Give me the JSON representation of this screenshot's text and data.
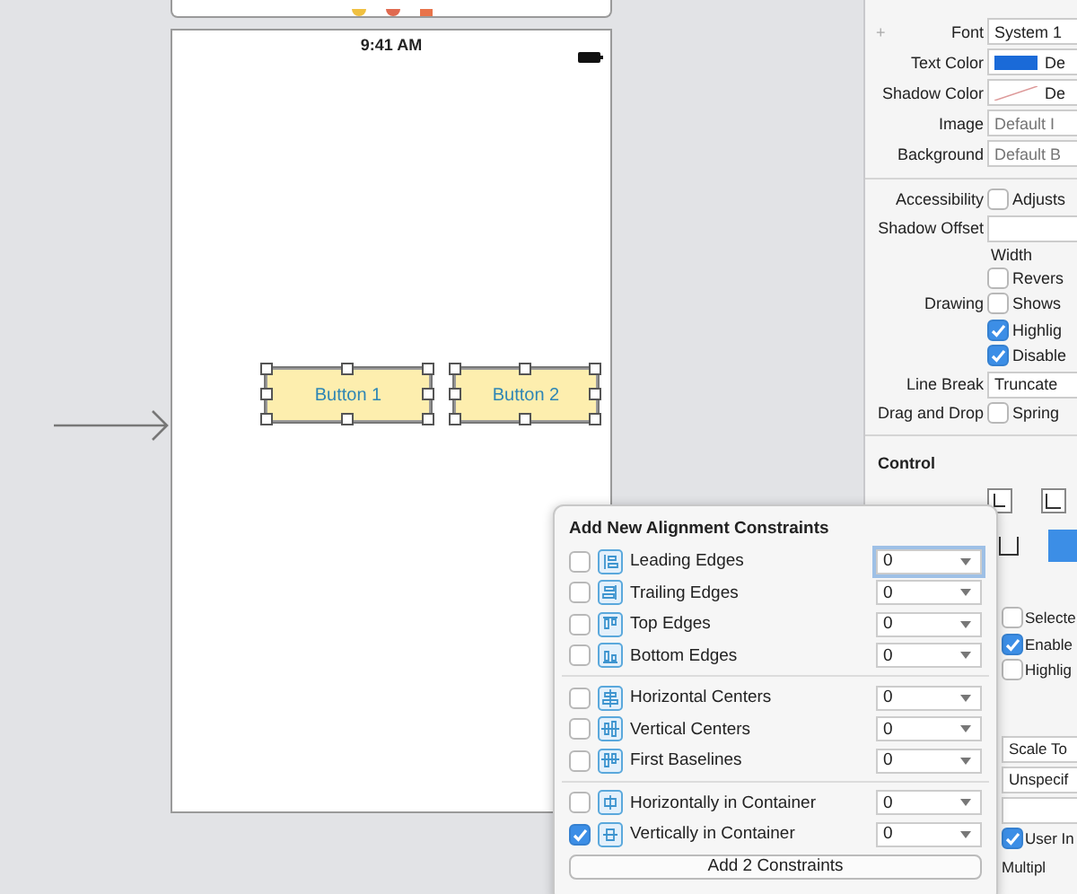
{
  "canvas": {
    "status_time": "9:41 AM",
    "buttons": [
      {
        "label": "Button 1",
        "selected": true
      },
      {
        "label": "Button 2",
        "selected": true
      }
    ]
  },
  "inspector": {
    "sections": [
      {
        "divided": false,
        "rows": [
          {
            "kind": "field",
            "label": "Font",
            "value": "System 1",
            "add": "+"
          },
          {
            "kind": "color",
            "label": "Text Color",
            "value": "De",
            "color": "#1a6ad8"
          },
          {
            "kind": "clear-color",
            "label": "Shadow Color",
            "value": "De"
          },
          {
            "kind": "placeholder",
            "label": "Image",
            "placeholder": "Default I"
          },
          {
            "kind": "placeholder",
            "label": "Background",
            "placeholder": "Default B"
          }
        ]
      },
      {
        "divided": true,
        "rows": [
          {
            "kind": "checkbox",
            "label": "Accessibility",
            "value": "Adjusts",
            "checked": false
          },
          {
            "kind": "field",
            "label": "Shadow Offset",
            "value": ""
          },
          {
            "kind": "caption",
            "value": "Width"
          },
          {
            "kind": "checkbox",
            "value": "Revers",
            "checked": false
          },
          {
            "kind": "checkbox",
            "label": "Drawing",
            "value": "Shows",
            "checked": false
          },
          {
            "kind": "checkbox",
            "value": "Highlig",
            "checked": true
          },
          {
            "kind": "checkbox",
            "value": "Disable",
            "checked": true
          },
          {
            "kind": "field",
            "label": "Line Break",
            "value": "Truncate"
          },
          {
            "kind": "checkbox",
            "label": "Drag and Drop",
            "value": "Spring",
            "checked": false
          }
        ]
      },
      {
        "divided": true,
        "rows": [
          {
            "kind": "heading",
            "label": "Control"
          },
          {
            "kind": "icons"
          },
          {
            "kind": "icons2"
          }
        ]
      },
      {
        "divided": false,
        "rows": [
          {
            "kind": "checkbox",
            "value": "Selecte",
            "checked": false
          },
          {
            "kind": "checkbox",
            "value": "Enable",
            "checked": true
          },
          {
            "kind": "checkbox",
            "value": "Highlig",
            "checked": false
          }
        ]
      },
      {
        "divided": false,
        "rows": [
          {
            "kind": "field",
            "value": "Scale To"
          },
          {
            "kind": "field",
            "value": "Unspecif"
          },
          {
            "kind": "field",
            "value": ""
          },
          {
            "kind": "checkbox",
            "value": "User In",
            "checked": true
          },
          {
            "kind": "text",
            "value": "Multipl"
          }
        ]
      }
    ]
  },
  "popover": {
    "title": "Add New Alignment Constraints",
    "groups": [
      [
        {
          "label": "Leading Edges",
          "checked": false,
          "value": "0",
          "focused": true
        },
        {
          "label": "Trailing Edges",
          "checked": false,
          "value": "0",
          "focused": false
        },
        {
          "label": "Top Edges",
          "checked": false,
          "value": "0",
          "focused": false
        },
        {
          "label": "Bottom Edges",
          "checked": false,
          "value": "0",
          "focused": false
        }
      ],
      [
        {
          "label": "Horizontal Centers",
          "checked": false,
          "value": "0",
          "focused": false
        },
        {
          "label": "Vertical Centers",
          "checked": false,
          "value": "0",
          "focused": false
        },
        {
          "label": "First Baselines",
          "checked": false,
          "value": "0",
          "focused": false
        }
      ],
      [
        {
          "label": "Horizontally in Container",
          "checked": false,
          "value": "0",
          "focused": false
        },
        {
          "label": "Vertically in Container",
          "checked": true,
          "value": "0",
          "focused": false
        }
      ]
    ],
    "button": "Add 2 Constraints"
  }
}
